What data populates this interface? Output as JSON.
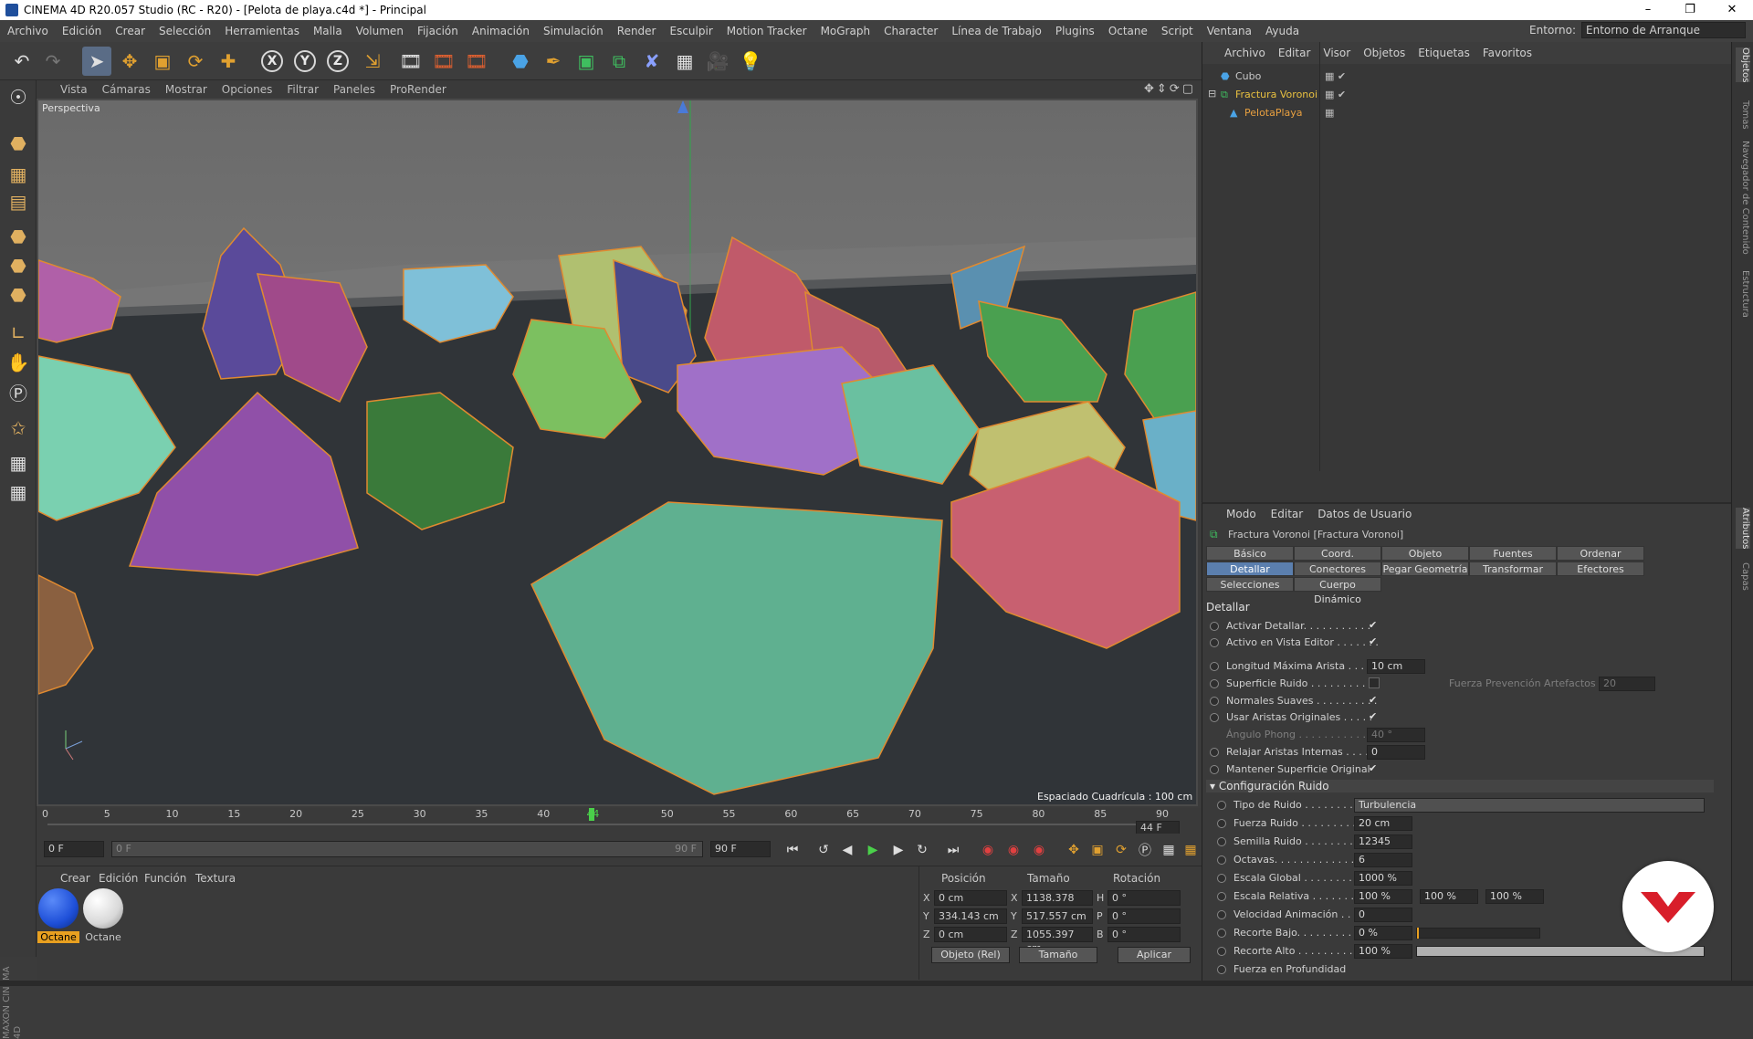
{
  "window": {
    "title": "CINEMA 4D R20.057 Studio (RC - R20) - [Pelota de playa.c4d *] - Principal"
  },
  "menubar": {
    "items": [
      "Archivo",
      "Edición",
      "Crear",
      "Selección",
      "Herramientas",
      "Malla",
      "Volumen",
      "Fijación",
      "Animación",
      "Simulación",
      "Render",
      "Esculpir",
      "Motion Tracker",
      "MoGraph",
      "Character",
      "Línea de Trabajo",
      "Plugins",
      "Octane",
      "Script",
      "Ventana",
      "Ayuda"
    ],
    "env_label": "Entorno:",
    "env_value": "Entorno de Arranque"
  },
  "viewport": {
    "menu": [
      "Vista",
      "Cámaras",
      "Mostrar",
      "Opciones",
      "Filtrar",
      "Paneles",
      "ProRender"
    ],
    "camera_label": "Perspectiva",
    "grid_label": "Espaciado Cuadrícula : 100 cm"
  },
  "timeline": {
    "ticks": [
      "0",
      "5",
      "10",
      "15",
      "20",
      "25",
      "30",
      "35",
      "40",
      "44",
      "50",
      "55",
      "60",
      "65",
      "70",
      "75",
      "80",
      "85",
      "90"
    ],
    "current_frame_label": "44",
    "end_field": "44 F",
    "start_field": "0 F",
    "range_start": "0 F",
    "range_end": "90 F",
    "max_field": "90 F"
  },
  "material_panel": {
    "menu": [
      "Crear",
      "Edición",
      "Función",
      "Textura"
    ],
    "materials": [
      {
        "label": "Octane",
        "color": "#1e4fd8",
        "selected": true
      },
      {
        "label": "Octane",
        "color": "#e8e8e8",
        "selected": false
      }
    ]
  },
  "coord_panel": {
    "headers": [
      "Posición",
      "Tamaño",
      "Rotación"
    ],
    "rows": [
      {
        "axis": "X",
        "pos": "0 cm",
        "size_axis": "X",
        "size": "1138.378 cm",
        "rot_axis": "H",
        "rot": "0 °"
      },
      {
        "axis": "Y",
        "pos": "334.143 cm",
        "size_axis": "Y",
        "size": "517.557 cm",
        "rot_axis": "P",
        "rot": "0 °"
      },
      {
        "axis": "Z",
        "pos": "0 cm",
        "size_axis": "Z",
        "size": "1055.397 cm",
        "rot_axis": "B",
        "rot": "0 °"
      }
    ],
    "mode_select": "Objeto (Rel)",
    "size_select": "Tamaño",
    "apply": "Aplicar"
  },
  "object_manager": {
    "menu": [
      "Archivo",
      "Editar",
      "Visor",
      "Objetos",
      "Etiquetas",
      "Favoritos"
    ],
    "objects": [
      {
        "name": "Cubo",
        "color": "#c8c8c8"
      },
      {
        "name": "Fractura Voronoi",
        "color": "#e8c040"
      },
      {
        "name": "PelotaPlaya",
        "color": "#e8a040"
      }
    ]
  },
  "attributes": {
    "menu": [
      "Modo",
      "Editar",
      "Datos de Usuario"
    ],
    "object_title": "Fractura Voronoi [Fractura Voronoi]",
    "tabs_row1": [
      "Básico",
      "Coord.",
      "Objeto",
      "Fuentes",
      "Ordenar"
    ],
    "tabs_row2": [
      "Detallar",
      "Conectores",
      "Pegar Geometría",
      "Transformar",
      "Efectores"
    ],
    "tabs_row3": [
      "Selecciones",
      "Cuerpo Dinámico"
    ],
    "active_tab": "Detallar",
    "section1": "Detallar",
    "props1": [
      {
        "label": "Activar Detallar. . . . . . . . . . .",
        "value": "✔"
      },
      {
        "label": "Activo en Vista Editor . . . . . . .",
        "value": "✔"
      },
      {
        "label": "Longitud Máxima Arista . . . .",
        "value": "10 cm"
      },
      {
        "label": "Superficie Ruido . . . . . . . . . . .",
        "value": "",
        "extra_label": "Fuerza Prevención Artefactos",
        "extra_value": "20"
      },
      {
        "label": "Normales Suaves . . . . . . . . . .",
        "value": "✔"
      },
      {
        "label": "Usar Aristas Originales . . . . .",
        "value": "✔"
      },
      {
        "label": "Ángulo Phong . . . . . . . . . . . . .",
        "value": "40 °"
      },
      {
        "label": "Relajar Aristas Internas . . . .",
        "value": "0"
      },
      {
        "label": "Mantener Superficie Original",
        "value": "✔"
      }
    ],
    "section2": "Configuración Ruido",
    "props2": [
      {
        "label": "Tipo de Ruido . . . . . . . . . . .",
        "value": "Turbulencia"
      },
      {
        "label": "Fuerza Ruido . . . . . . . . . . . .",
        "value": "20 cm"
      },
      {
        "label": "Semilla Ruido . . . . . . . . . . . .",
        "value": "12345"
      },
      {
        "label": "Octavas. . . . . . . . . . . . . . . . . .",
        "value": "6"
      },
      {
        "label": "Escala Global . . . . . . . . . . . .",
        "value": "1000 %"
      },
      {
        "label": "Escala Relativa . . . . . . . . . . .",
        "value": "100 %",
        "v2": "100 %",
        "v3": "100 %"
      },
      {
        "label": "Velocidad Animación . . . . . .",
        "value": "0"
      },
      {
        "label": "Recorte Bajo. . . . . . . . . . . . . .",
        "value": "0 %",
        "fill": 0
      },
      {
        "label": "Recorte Alto . . . . . . . . . . . . . .",
        "value": "100 %",
        "fill": 1
      },
      {
        "label": "Fuerza en Profundidad",
        "value": ""
      }
    ]
  },
  "right_strip": [
    "Objetos",
    "Tomas",
    "Navegador de Contenido",
    "Estructura",
    "Atributos",
    "Capas"
  ]
}
